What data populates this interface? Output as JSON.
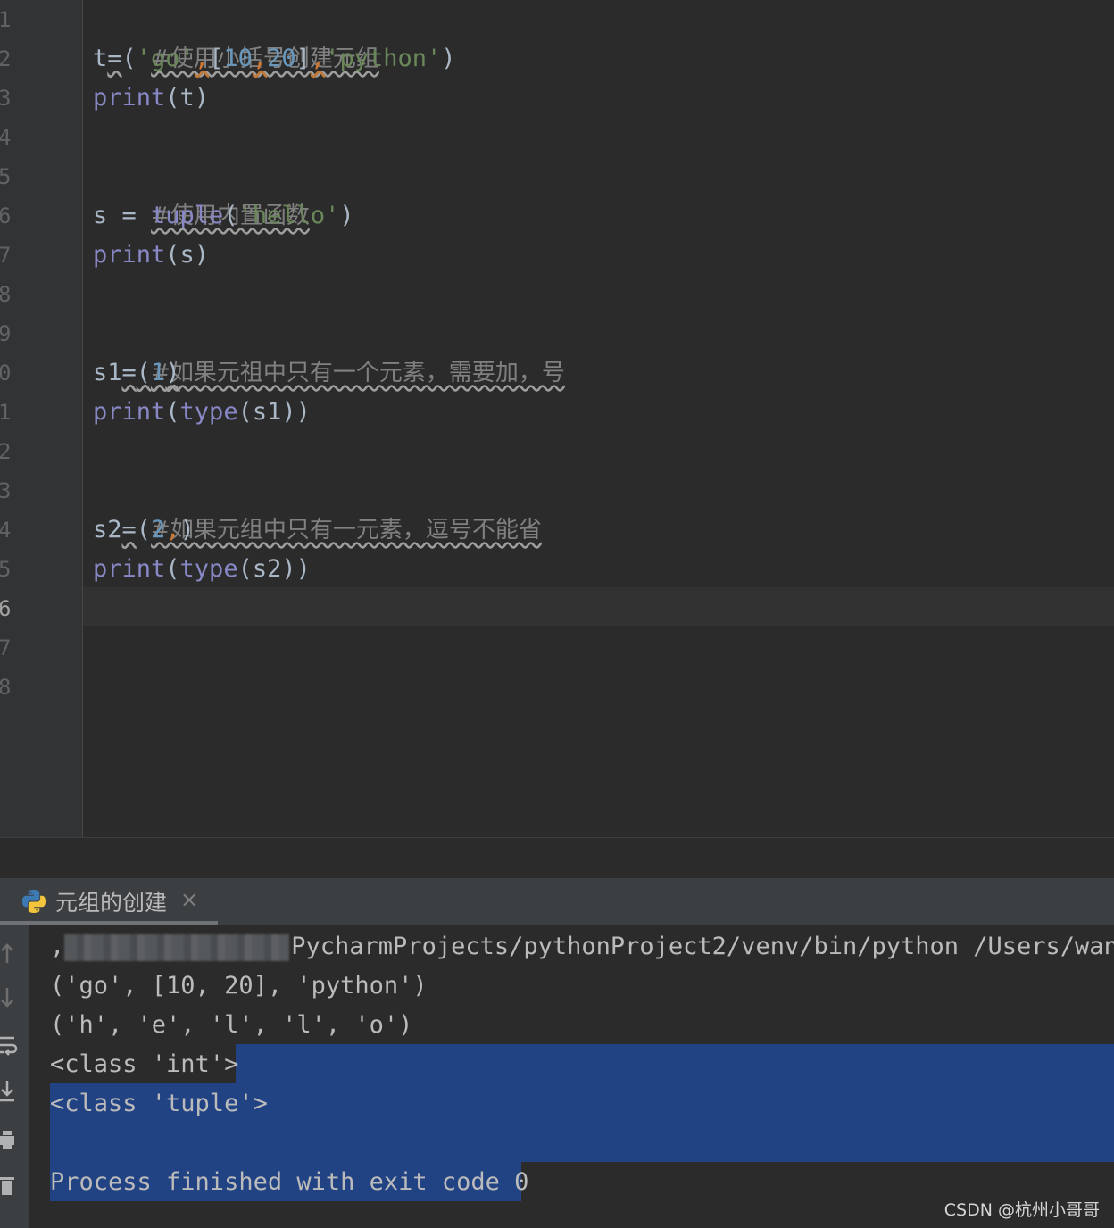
{
  "editor": {
    "line_numbers": [
      "1",
      "2",
      "3",
      "4",
      "5",
      "6",
      "7",
      "8",
      "9",
      "0",
      "1",
      "2",
      "3",
      "4",
      "5",
      "6",
      "7",
      "8"
    ],
    "current_line_index": 15,
    "code": {
      "l1_comment": "#使用小括号创建元组",
      "l2_t": "t",
      "l2_eq": "=",
      "l2_open": "(",
      "l2_go": "'go'",
      "l2_c1": ",",
      "l2_lb": "[",
      "l2_10": "10",
      "l2_c2": ",",
      "l2_20": "20",
      "l2_rb": "]",
      "l2_c3": ",",
      "l2_python": "'python'",
      "l2_close": ")",
      "l3_print": "print",
      "l3_rest": "(t)",
      "l5_comment": "#使用内置函数",
      "l6_s": "s = ",
      "l6_tuple": "tuple",
      "l6_open": "(",
      "l6_hello": "'hello'",
      "l6_close": ")",
      "l7_print": "print",
      "l7_rest": "(s)",
      "l9_comment": "#如果元祖中只有一个元素，需要加，号",
      "l10_s1": "s1",
      "l10_eq": "=",
      "l10_open": "(",
      "l10_1": "1",
      "l10_close": ")",
      "l11_print": "print",
      "l11_open": "(",
      "l11_type": "type",
      "l11_rest": "(s1))",
      "l13_comment": "#如果元组中只有一元素，逗号不能省",
      "l14_s2": "s2",
      "l14_eq": "=",
      "l14_open": "(",
      "l14_2": "2",
      "l14_comma": ",",
      "l14_close": ")",
      "l15_print": "print",
      "l15_open": "(",
      "l15_type": "type",
      "l15_rest": "(s2))"
    }
  },
  "run_panel": {
    "tab_label": "元组的创建",
    "tab_close": "×",
    "tab_icon": "python-icon",
    "tools": [
      "up-arrow-icon",
      "down-arrow-icon",
      "soft-wrap-icon",
      "scroll-to-end-icon",
      "print-icon",
      "trash-icon"
    ],
    "output": {
      "cmd_prefix": ",",
      "cmd_visible": "PycharmProjects/pythonProject2/venv/bin/python /Users/wangz",
      "line2": "('go', [10, 20], 'python')",
      "line3": "('h', 'e', 'l', 'l', 'o')",
      "line4": "<class 'int'>",
      "line5": "<class 'tuple'>",
      "line7": "Process finished with exit code 0"
    },
    "selection_color": "#214283"
  },
  "watermark": "CSDN @杭州小哥哥",
  "colors": {
    "background": "#2b2b2b",
    "keyword": "#8888c6",
    "string": "#6a8759",
    "number": "#6897bb",
    "comment": "#808080",
    "comma": "#cc7832"
  }
}
